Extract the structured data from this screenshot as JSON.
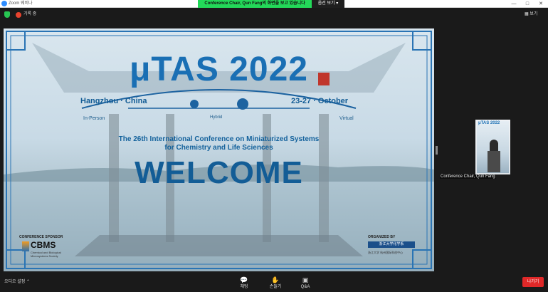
{
  "titlebar": {
    "app_title": "Zoom 웨비나",
    "share_banner": "Conference Chair, Qun Fang의 화면을 보고 있습니다",
    "view_options": "옵션 보기",
    "controls": [
      "—",
      "□",
      "✕"
    ]
  },
  "status": {
    "recording_label": "기록 중",
    "view_label": "보기"
  },
  "slide": {
    "title": "μTAS 2022",
    "city": "Hangzhou · China",
    "dates": "23-27 · October",
    "mode_left": "In-Person",
    "mode_center": "Hybrid",
    "mode_right": "Virtual",
    "conference_line1": "The 26th International Conference on Miniaturized Systems",
    "conference_line2": "for Chemistry and Life Sciences",
    "welcome": "WELCOME",
    "sponsor_label": "CONFERENCE SPONSOR",
    "sponsor_name": "CBMS",
    "sponsor_sub": "Chemical and Biological Microsystems Society",
    "organizer_label": "ORGANIZED BY",
    "organizer_name": "浙江大学化学系",
    "organizer_sub": "浙江大学 杭州国际科创中心"
  },
  "video_tile": {
    "banner_title": "μTAS 2022",
    "participant_name": "Conference Chair, Qun Fang"
  },
  "toolbar": {
    "audio_settings": "오디오 설정",
    "items": [
      {
        "label": "채팅",
        "icon": "chat-icon"
      },
      {
        "label": "손들기",
        "icon": "raise-hand-icon"
      },
      {
        "label": "Q&A",
        "icon": "qa-icon"
      }
    ],
    "leave_label": "나가기"
  },
  "colors": {
    "share_banner": "#23d959",
    "leave": "#e02828",
    "brand_blue": "#135d96"
  }
}
